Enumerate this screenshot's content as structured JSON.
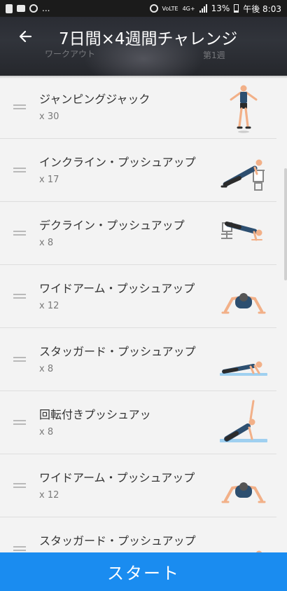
{
  "status_bar": {
    "battery": "13%",
    "time": "午後 8:03",
    "network": "4G+",
    "volte": "VoLTE"
  },
  "header": {
    "title": "7日間×4週間チャレンジ",
    "subtitle_left": "ワークアウト",
    "subtitle_right": "第1週",
    "back_icon": "back-arrow-icon"
  },
  "exercises": [
    {
      "name": "ジャンピングジャック",
      "reps": "x 30",
      "figure": "jumping-jack"
    },
    {
      "name": "インクライン・プッシュアップ",
      "reps": "x 17",
      "figure": "incline-pushup"
    },
    {
      "name": "デクライン・プッシュアップ",
      "reps": "x 8",
      "figure": "decline-pushup"
    },
    {
      "name": "ワイドアーム・プッシュアップ",
      "reps": "x 12",
      "figure": "wide-pushup"
    },
    {
      "name": "スタッガード・プッシュアップ",
      "reps": "x 8",
      "figure": "staggered-pushup"
    },
    {
      "name": "回転付きプッシュアッ",
      "reps": "x 8",
      "figure": "rotation-pushup"
    },
    {
      "name": "ワイドアーム・プッシュアップ",
      "reps": "x 12",
      "figure": "wide-pushup"
    },
    {
      "name": "スタッガード・プッシュアップ",
      "reps": "",
      "figure": "staggered-pushup"
    }
  ],
  "start_button": "スタート",
  "colors": {
    "accent": "#1a8cf0",
    "shirt": "#2d4f70",
    "skin": "#f2b088",
    "mat": "#9fd0f0",
    "equipment": "#888888"
  }
}
